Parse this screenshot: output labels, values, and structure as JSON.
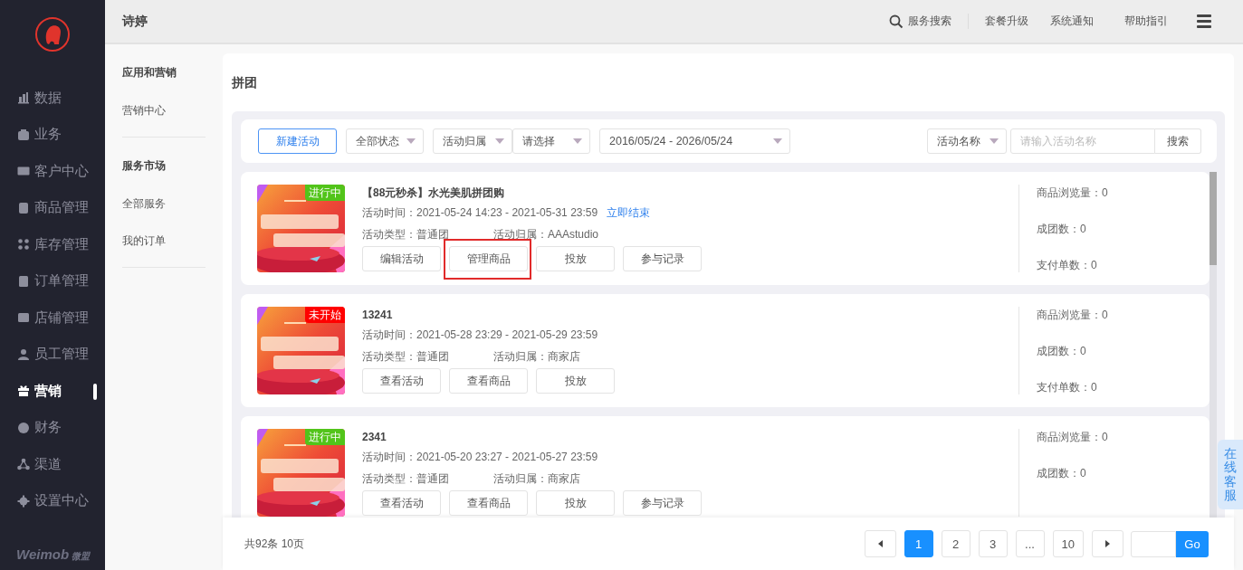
{
  "sidebar": {
    "items": [
      {
        "label": "数据",
        "selected": false
      },
      {
        "label": "业务",
        "selected": false
      },
      {
        "label": "客户中心",
        "selected": false
      },
      {
        "label": "商品管理",
        "selected": false
      },
      {
        "label": "库存管理",
        "selected": false
      },
      {
        "label": "订单管理",
        "selected": false
      },
      {
        "label": "店铺管理",
        "selected": false
      },
      {
        "label": "员工管理",
        "selected": false
      },
      {
        "label": "营销",
        "selected": true
      },
      {
        "label": "财务",
        "selected": false
      },
      {
        "label": "渠道",
        "selected": false
      },
      {
        "label": "设置中心",
        "selected": false
      }
    ],
    "brand": "Weimob",
    "brand_cn": "微盟"
  },
  "topbar": {
    "title": "诗婷",
    "search": "服务搜索",
    "links": [
      "套餐升级",
      "系统通知",
      "帮助指引"
    ]
  },
  "subnav": {
    "sections": [
      {
        "heading": "应用和营销",
        "items": [
          "营销中心"
        ]
      },
      {
        "heading": "服务市场",
        "items": [
          "全部服务",
          "我的订单"
        ]
      }
    ]
  },
  "page": {
    "title": "拼团"
  },
  "filters": {
    "new_button": "新建活动",
    "status_select": "全部状态",
    "owner_select": "活动归属",
    "owner_value": "请选择",
    "date_range": "2016/05/24 - 2026/05/24",
    "name_select": "活动名称",
    "search_placeholder": "请输入活动名称",
    "search_button": "搜索"
  },
  "activities": [
    {
      "title": "【88元秒杀】水光美肌拼团购",
      "status": "进行中",
      "color": "#52c41a",
      "time": "活动时间：2021-05-24 14:23 - 2021-05-31 23:59",
      "end_link": "立即结束",
      "type": "活动类型：普通团",
      "owner": "活动归属：AAAstudio",
      "buttons": [
        {
          "label": "编辑活动",
          "highlighted": false
        },
        {
          "label": "管理商品",
          "highlighted": true
        },
        {
          "label": "投放",
          "highlighted": false
        },
        {
          "label": "参与记录",
          "highlighted": false
        }
      ],
      "stats": [
        "商品浏览量：0",
        "成团数：0",
        "支付单数：0"
      ]
    },
    {
      "title": "13241",
      "status": "未开始",
      "color": "#ff0000",
      "time": "活动时间：2021-05-28 23:29 - 2021-05-29 23:59",
      "type": "活动类型：普通团",
      "owner": "活动归属：商家店",
      "buttons": [
        {
          "label": "查看活动",
          "highlighted": false
        },
        {
          "label": "查看商品",
          "highlighted": false
        },
        {
          "label": "投放",
          "highlighted": false
        }
      ],
      "stats": [
        "商品浏览量：0",
        "成团数：0",
        "支付单数：0"
      ]
    },
    {
      "title": "2341",
      "status": "进行中",
      "color": "#52c41a",
      "time": "活动时间：2021-05-20 23:27 - 2021-05-27 23:59",
      "type": "活动类型：普通团",
      "owner": "活动归属：商家店",
      "buttons": [
        {
          "label": "查看活动",
          "highlighted": false
        },
        {
          "label": "查看商品",
          "highlighted": false
        },
        {
          "label": "投放",
          "highlighted": false
        },
        {
          "label": "参与记录",
          "highlighted": false
        }
      ],
      "stats": [
        "商品浏览量：0",
        "成团数：0"
      ]
    }
  ],
  "pagination": {
    "summary": "共92条 10页",
    "pages": [
      {
        "label": "1",
        "selected": true
      },
      {
        "label": "2",
        "selected": false
      },
      {
        "label": "3",
        "selected": false
      },
      {
        "label": "...",
        "selected": false
      },
      {
        "label": "10",
        "selected": false
      }
    ],
    "go": "Go"
  },
  "chat_tab": "在线客服"
}
